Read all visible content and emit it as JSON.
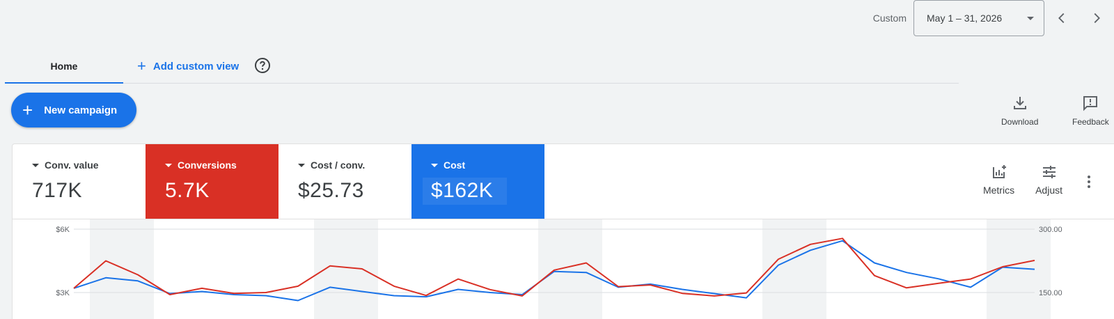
{
  "date": {
    "mode": "Custom",
    "range": "May 1 – 31, 2026"
  },
  "tabs": {
    "home": "Home",
    "add": "Add custom view"
  },
  "actions": {
    "new_campaign": "New campaign",
    "download": "Download",
    "feedback": "Feedback"
  },
  "metrics": [
    {
      "label": "Conv. value",
      "value": "717K"
    },
    {
      "label": "Conversions",
      "value": "5.7K",
      "color": "#d93025"
    },
    {
      "label": "Cost / conv.",
      "value": "$25.73"
    },
    {
      "label": "Cost",
      "value": "$162K",
      "color": "#1a73e8"
    }
  ],
  "card_tools": {
    "metrics": "Metrics",
    "adjust": "Adjust"
  },
  "chart_data": {
    "type": "line",
    "x": [
      1,
      2,
      3,
      4,
      5,
      6,
      7,
      8,
      9,
      10,
      11,
      12,
      13,
      14,
      15,
      16,
      17,
      18,
      19,
      20,
      21,
      22,
      23,
      24,
      25,
      26,
      27,
      28,
      29,
      30,
      31
    ],
    "left_axis": {
      "ticks": [
        "$6K",
        "$3K"
      ],
      "range": [
        0,
        6000
      ]
    },
    "right_axis": {
      "ticks": [
        "300.00",
        "150.00"
      ],
      "range": [
        0,
        300
      ]
    },
    "series": [
      {
        "name": "Cost",
        "color": "#1a73e8",
        "axis": "left",
        "values": [
          3200,
          3700,
          3550,
          2950,
          3050,
          2900,
          2850,
          2620,
          3250,
          3050,
          2850,
          2800,
          3150,
          3000,
          2900,
          4000,
          3950,
          3250,
          3400,
          3150,
          2950,
          2750,
          4300,
          5000,
          5450,
          4400,
          3950,
          3650,
          3250,
          4200,
          4100
        ]
      },
      {
        "name": "Conversions",
        "color": "#d93025",
        "axis": "right",
        "values": [
          160,
          225,
          192,
          145,
          160,
          148,
          150,
          165,
          213,
          206,
          165,
          143,
          182,
          157,
          142,
          203,
          220,
          164,
          168,
          148,
          142,
          149,
          229,
          264,
          278,
          190,
          161,
          172,
          182,
          211,
          226
        ]
      }
    ],
    "weekends": [
      2,
      3,
      9,
      10,
      16,
      17,
      23,
      24,
      30,
      31
    ]
  }
}
